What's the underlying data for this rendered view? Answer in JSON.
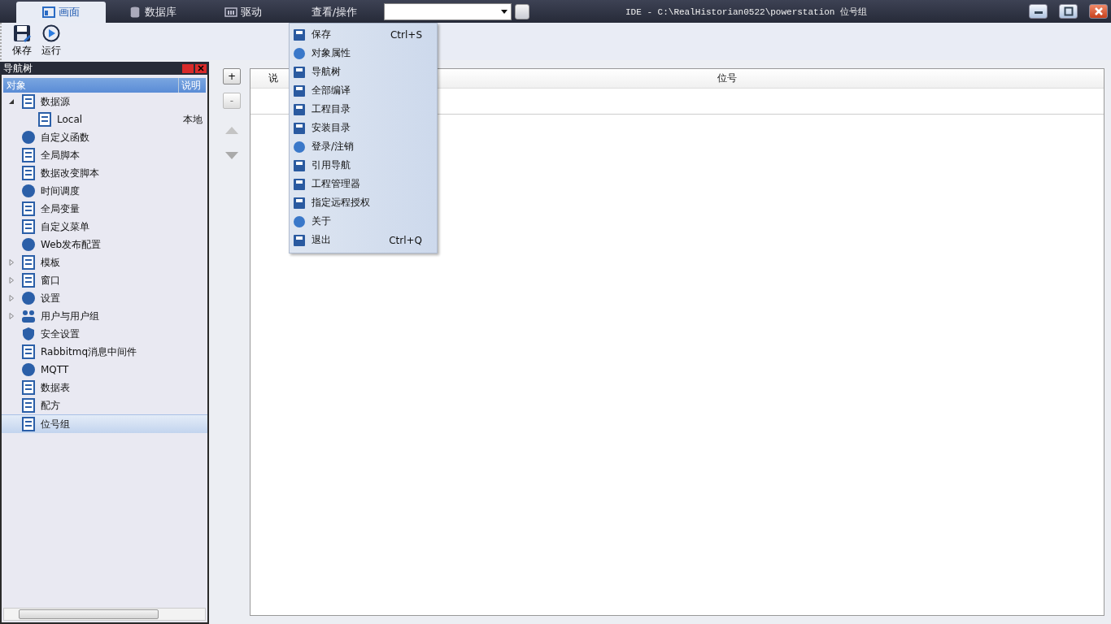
{
  "tabs": [
    {
      "label": "画面",
      "selected": true
    },
    {
      "label": "数据库",
      "selected": false
    },
    {
      "label": "驱动",
      "selected": false
    },
    {
      "label": "查看/操作",
      "selected": false
    }
  ],
  "window": {
    "title": "IDE - C:\\RealHistorian0522\\powerstation  位号组"
  },
  "toolbar": [
    {
      "label": "保存"
    },
    {
      "label": "运行"
    }
  ],
  "nav_tree": {
    "title": "导航树",
    "columns": [
      "对象",
      "说明"
    ],
    "items": [
      {
        "label": "数据源",
        "expanded": true,
        "selected": false,
        "children": [
          {
            "label": "Local",
            "description": "本地",
            "selected": false
          }
        ]
      },
      {
        "label": "自定义函数",
        "selected": false
      },
      {
        "label": "全局脚本",
        "selected": false
      },
      {
        "label": "数据改变脚本",
        "selected": false
      },
      {
        "label": "时间调度",
        "selected": false
      },
      {
        "label": "全局变量",
        "selected": false
      },
      {
        "label": "自定义菜单",
        "selected": false
      },
      {
        "label": "Web发布配置",
        "selected": false
      },
      {
        "label": "模板",
        "expanded": false,
        "selected": false
      },
      {
        "label": "窗口",
        "expanded": false,
        "selected": false
      },
      {
        "label": "设置",
        "expanded": false,
        "selected": false
      },
      {
        "label": "用户与用户组",
        "expanded": false,
        "selected": false
      },
      {
        "label": "安全设置",
        "selected": false
      },
      {
        "label": "Rabbitmq消息中间件",
        "selected": false
      },
      {
        "label": "MQTT",
        "selected": false
      },
      {
        "label": "数据表",
        "selected": false
      },
      {
        "label": "配方",
        "selected": false
      },
      {
        "label": "位号组",
        "selected": true
      }
    ]
  },
  "side_buttons": [
    "+",
    "-"
  ],
  "table": {
    "columns": [
      "说",
      "位号"
    ]
  },
  "menu": {
    "items": [
      {
        "label": "保存",
        "shortcut": "Ctrl+S"
      },
      {
        "label": "对象属性"
      },
      {
        "label": "导航树"
      },
      {
        "label": "全部编译"
      },
      {
        "label": "工程目录"
      },
      {
        "label": "安装目录"
      },
      {
        "label": "登录/注销"
      },
      {
        "label": "引用导航"
      },
      {
        "label": "工程管理器"
      },
      {
        "label": "指定远程授权"
      },
      {
        "label": "关于"
      },
      {
        "label": "退出",
        "shortcut": "Ctrl+Q"
      }
    ]
  }
}
